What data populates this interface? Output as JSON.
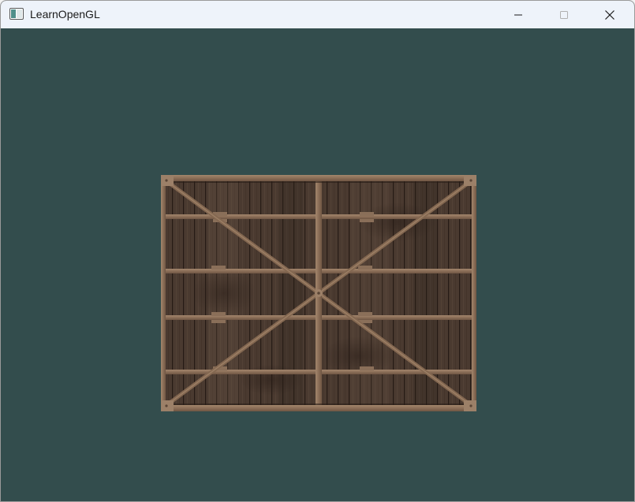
{
  "window": {
    "title": "LearnOpenGL",
    "app_icon": "window-app-icon",
    "controls": [
      "minimize-icon",
      "maximize-icon",
      "close-icon"
    ]
  },
  "scene": {
    "background_color": "#334d4d",
    "object": "wooden-crate-texture"
  }
}
